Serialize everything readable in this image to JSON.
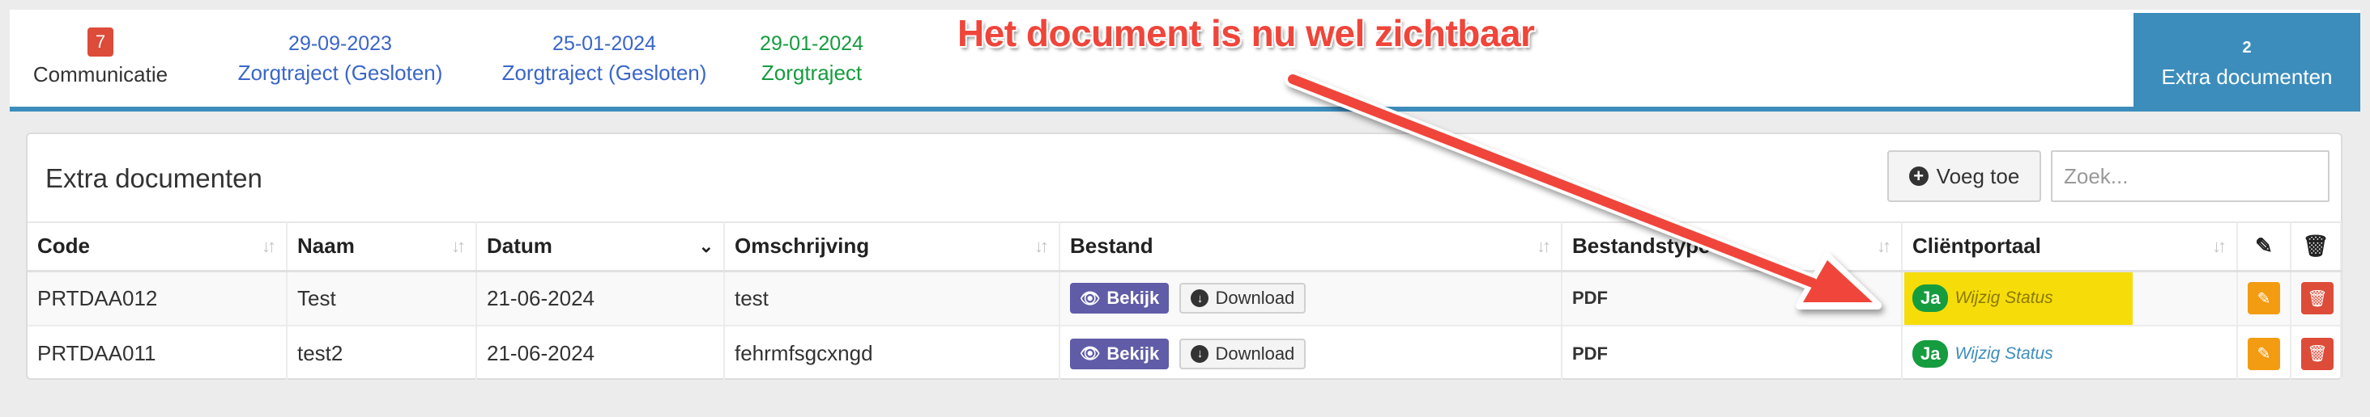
{
  "tabs": [
    {
      "badge": "7",
      "label": "Communicatie"
    },
    {
      "date": "29-09-2023",
      "label": "Zorgtraject (Gesloten)"
    },
    {
      "date": "25-01-2024",
      "label": "Zorgtraject (Gesloten)"
    },
    {
      "date": "29-01-2024",
      "label": "Zorgtraject"
    },
    {
      "count": "2",
      "label": "Extra documenten"
    }
  ],
  "annotation": "Het document is nu wel zichtbaar",
  "panel": {
    "title": "Extra documenten",
    "add_label": "Voeg toe",
    "search_placeholder": "Zoek..."
  },
  "table": {
    "headers": [
      "Code",
      "Naam",
      "Datum",
      "Omschrijving",
      "Bestand",
      "Bestandstype",
      "Cliëntportaal"
    ],
    "rows": [
      {
        "code": "PRTDAA012",
        "naam": "Test",
        "datum": "21-06-2024",
        "omschrijving": "test",
        "view_label": "Bekijk",
        "download_label": "Download",
        "type": "PDF",
        "portal_badge": "Ja",
        "portal_link": "Wijzig Status"
      },
      {
        "code": "PRTDAA011",
        "naam": "test2",
        "datum": "21-06-2024",
        "omschrijving": "fehrmfsgcxngd",
        "view_label": "Bekijk",
        "download_label": "Download",
        "type": "PDF",
        "portal_badge": "Ja",
        "portal_link": "Wijzig Status"
      }
    ]
  },
  "colors": {
    "primary": "#3c8dbc",
    "annotation": "#f0453a",
    "highlight": "#f6dd0a",
    "success": "#159c3f",
    "danger": "#dd4b39",
    "warning": "#f39c12",
    "purple": "#605ca8"
  }
}
